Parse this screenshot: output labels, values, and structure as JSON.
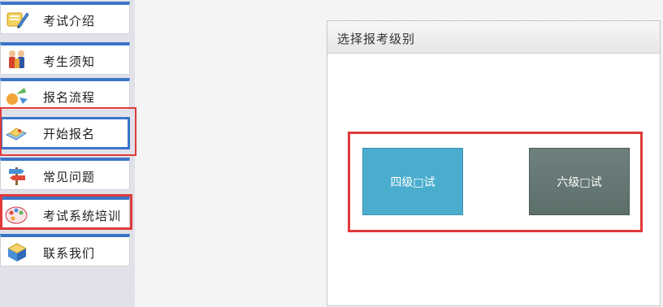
{
  "sidebar": {
    "items": [
      {
        "label": "考试介绍",
        "icon": "pencil-paper-icon"
      },
      {
        "label": "考生须知",
        "icon": "people-icon"
      },
      {
        "label": "报名流程",
        "icon": "flow-arrows-icon"
      },
      {
        "label": "开始报名",
        "icon": "open-book-icon"
      },
      {
        "label": "常见问题",
        "icon": "signpost-icon"
      },
      {
        "label": "考试系统培训",
        "icon": "palette-icon"
      },
      {
        "label": "联系我们",
        "icon": "contact-cube-icon"
      }
    ]
  },
  "panel": {
    "title": "选择报考级别",
    "buttons": {
      "cet4": "四级□试",
      "cet6": "六级□试"
    }
  },
  "colors": {
    "accent_blue": "#3a74c8",
    "highlight_red": "#e03a3a",
    "cet4_bg": "#4badce",
    "cet6_bg": "#65787a"
  }
}
